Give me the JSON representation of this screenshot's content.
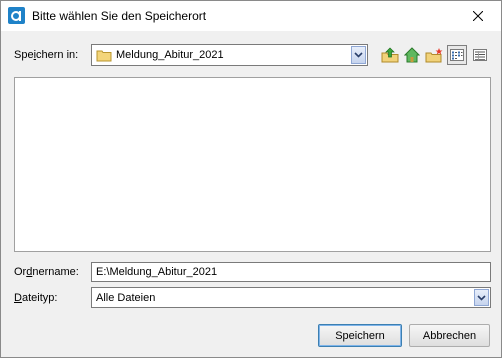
{
  "window": {
    "title": "Bitte wählen Sie den Speicherort"
  },
  "location": {
    "label_pre": "Spe",
    "label_accel": "i",
    "label_post": "chern in:",
    "folder": "Meldung_Abitur_2021"
  },
  "toolbar": {
    "up_icon": "folder-up-icon",
    "home_icon": "home-icon",
    "new_folder_icon": "new-folder-icon",
    "list_icon": "list-view-icon",
    "details_icon": "details-view-icon"
  },
  "folder_name": {
    "label_pre": "Or",
    "label_accel": "d",
    "label_post": "nername:",
    "value": "E:\\Meldung_Abitur_2021"
  },
  "file_type": {
    "label_pre": "",
    "label_accel": "D",
    "label_post": "ateityp:",
    "value": "Alle Dateien"
  },
  "buttons": {
    "save": "Speichern",
    "cancel": "Abbrechen"
  },
  "colors": {
    "accent": "#1f82c8",
    "folder": "#f3d57a"
  }
}
